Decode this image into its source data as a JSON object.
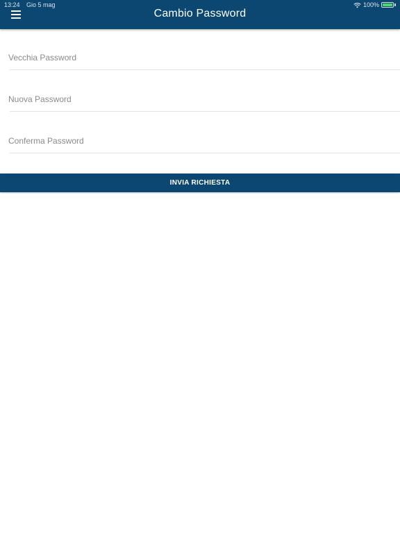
{
  "status_bar": {
    "time": "13:24",
    "date": "Gio 5 mag",
    "battery": "100%"
  },
  "header": {
    "title": "Cambio Password",
    "menu_icon": "hamburger-menu-icon"
  },
  "form": {
    "old_password": {
      "placeholder": "Vecchia Password",
      "value": ""
    },
    "new_password": {
      "placeholder": "Nuova Password",
      "value": ""
    },
    "confirm_password": {
      "placeholder": "Conferma Password",
      "value": ""
    },
    "submit_label": "INVIA RICHIESTA"
  },
  "colors": {
    "primary": "#0b4770",
    "battery": "#4cd964"
  }
}
